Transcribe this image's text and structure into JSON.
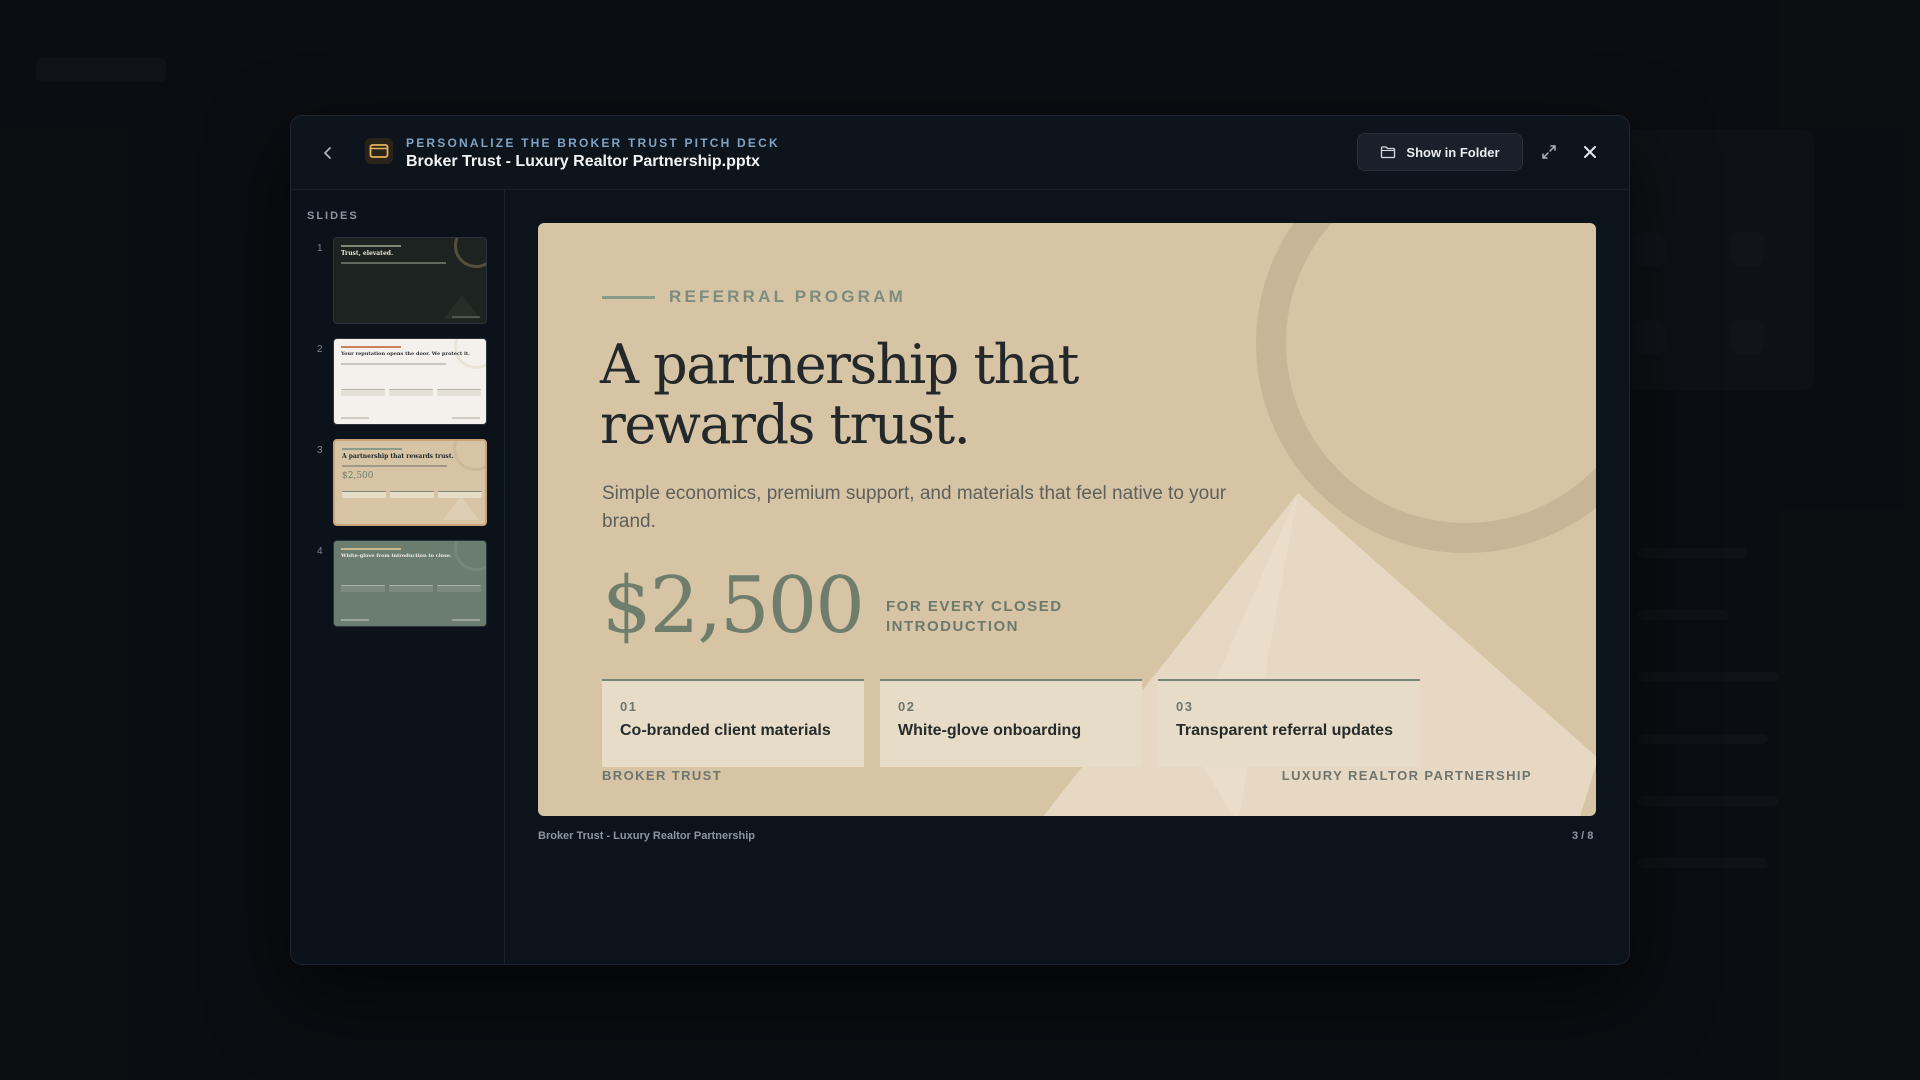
{
  "header": {
    "eyebrow": "PERSONALIZE THE BROKER TRUST PITCH DECK",
    "title": "Broker Trust - Luxury Realtor Partnership.pptx",
    "show_in_folder_label": "Show in Folder"
  },
  "icons": {
    "back": "chevron-left-icon",
    "file": "presentation-icon",
    "folder": "folder-icon",
    "expand": "expand-icon",
    "close": "close-icon"
  },
  "sidebar": {
    "label": "SLIDES",
    "thumbnails": [
      {
        "number": "1",
        "title": "Trust, elevated."
      },
      {
        "number": "2",
        "title": "Your reputation opens the door. We protect it."
      },
      {
        "number": "3",
        "title": "A partnership that rewards trust."
      },
      {
        "number": "4",
        "title": "White-glove from introduction to close."
      }
    ],
    "active_slide": 3
  },
  "slide": {
    "eyebrow": "REFERRAL PROGRAM",
    "title": "A partnership that rewards trust.",
    "subtitle": "Simple economics, premium support, and materials that feel native to your brand.",
    "amount": "$2,500",
    "amount_label": "FOR EVERY CLOSED INTRODUCTION",
    "cards": [
      {
        "num": "01",
        "title": "Co-branded client materials"
      },
      {
        "num": "02",
        "title": "White-glove onboarding"
      },
      {
        "num": "03",
        "title": "Transparent referral updates"
      }
    ],
    "footer_left": "BROKER TRUST",
    "footer_right": "LUXURY REALTOR PARTNERSHIP"
  },
  "stage": {
    "caption": "Broker Trust - Luxury Realtor Partnership",
    "counter": "3 / 8"
  },
  "colors": {
    "slide_bg": "#d6c4a5",
    "accent_sage": "#6f7e6c",
    "active_thumb_border": "#c7a376",
    "eyebrow_blue": "#7ea3c4"
  }
}
